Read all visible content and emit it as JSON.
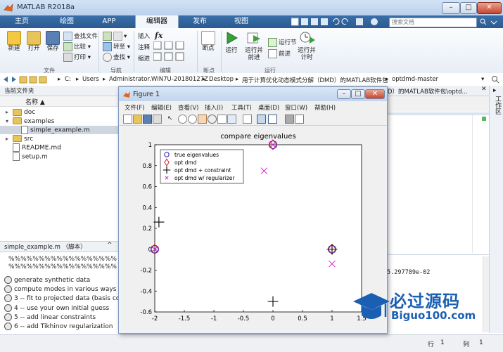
{
  "window": {
    "title": "MATLAB R2018a",
    "min": "–",
    "max": "□",
    "close": "✕"
  },
  "tabs": [
    {
      "label": "主页"
    },
    {
      "label": "绘图"
    },
    {
      "label": "APP"
    },
    {
      "label": "编辑器"
    },
    {
      "label": "发布"
    },
    {
      "label": "视图"
    }
  ],
  "search_placeholder": "搜索文档",
  "ribbon": {
    "file": {
      "new": "新建",
      "open": "打开",
      "save": "保存",
      "find_files": "查找文件",
      "compare": "比较",
      "print": "打印",
      "group": "文件"
    },
    "navigate": {
      "goto": "转至",
      "find": "查找",
      "group": "导航"
    },
    "edit": {
      "insert": "插入",
      "comment": "注释",
      "indent": "缩进",
      "fx": "fx",
      "group": "编辑"
    },
    "breakpoints": {
      "label": "断点",
      "group": "断点"
    },
    "run": {
      "run": "运行",
      "run_advance": "运行并\n前进",
      "run_section": "运行节",
      "advance": "前进",
      "run_time": "运行并\n计时",
      "group": "运行"
    }
  },
  "address": {
    "crumbs": [
      "C:",
      "Users",
      "Administrator.WIN7U-20180127Z",
      "Desktop",
      "用于计算优化动态模式分解（DMD）的MATLAB软件包",
      "optdmd-master"
    ]
  },
  "current_folder": {
    "title": "当前文件夹",
    "column": "名称 ▲",
    "items": [
      {
        "name": "doc",
        "type": "folder",
        "indent": 0
      },
      {
        "name": "examples",
        "type": "folder",
        "indent": 0
      },
      {
        "name": "simple_example.m",
        "type": "file",
        "indent": 1
      },
      {
        "name": "src",
        "type": "folder",
        "indent": 0
      },
      {
        "name": "README.md",
        "type": "file",
        "indent": 0
      },
      {
        "name": "setup.m",
        "type": "file",
        "indent": 0
      }
    ]
  },
  "details": {
    "title": "simple_example.m （脚本）",
    "percent_lines": [
      "%%%%%%%%%%%%%%%%%%",
      "%%%%%%%%%%%%%%%%%%"
    ],
    "outline": [
      "generate synthetic data",
      "compute modes in various ways",
      "3 -- fit to projected data (basis co...",
      "4 -- use your own initial guess",
      "5 -- add linear constraints",
      "6 -- add Tikhinov regularization"
    ]
  },
  "editor": {
    "breadcrumb": "D）的MATLAB软件包\\optd...",
    "side_label": "工作区"
  },
  "command": {
    "output": "5.297789e-02"
  },
  "status": {
    "line_label": "行",
    "line": "1",
    "col_label": "列",
    "col": "1"
  },
  "figure": {
    "title": "Figure 1",
    "menu": [
      "文件(F)",
      "编辑(E)",
      "查看(V)",
      "插入(I)",
      "工具(T)",
      "桌面(D)",
      "窗口(W)",
      "帮助(H)"
    ]
  },
  "chart_data": {
    "type": "scatter",
    "title": "compare eigenvalues",
    "xlim": [
      -2,
      1.5
    ],
    "ylim": [
      -0.6,
      1
    ],
    "xticks": [
      -2,
      -1.5,
      -1,
      -0.5,
      0,
      0.5,
      1,
      1.5
    ],
    "yticks": [
      -0.6,
      -0.4,
      -0.2,
      0,
      0.2,
      0.4,
      0.6,
      0.8,
      1
    ],
    "grid": false,
    "legend_position": "top-left",
    "series": [
      {
        "name": "true eigenvalues",
        "marker": "circle",
        "color": "#1f1fd6",
        "x": [
          -2,
          0,
          1
        ],
        "y": [
          0,
          1,
          0
        ]
      },
      {
        "name": "opt dmd",
        "marker": "diamond",
        "color": "#d62020",
        "x": [
          -2,
          0,
          1
        ],
        "y": [
          0,
          1,
          0
        ]
      },
      {
        "name": "opt dmd + constraint",
        "marker": "plus",
        "color": "#000000",
        "x": [
          -1.93,
          0,
          1
        ],
        "y": [
          0.26,
          -0.5,
          0
        ]
      },
      {
        "name": "opt dmd w/ regularizer",
        "marker": "x",
        "color": "#d61fd6",
        "x": [
          -2,
          -0.15,
          0,
          1
        ],
        "y": [
          0,
          0.75,
          1,
          -0.14
        ]
      }
    ]
  },
  "watermark": {
    "title": "必过源码",
    "url": "Biguo100.com"
  }
}
